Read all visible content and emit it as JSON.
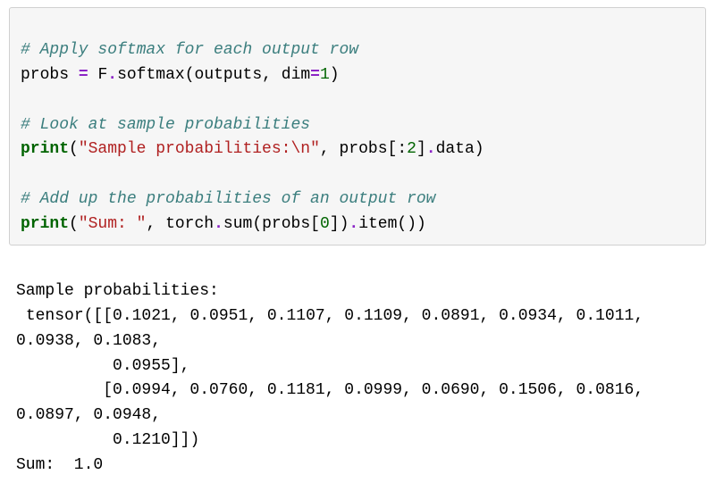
{
  "code": {
    "c1": "# Apply softmax for each output row",
    "l2_probs": "probs",
    "l2_sp1": " ",
    "l2_eq": "=",
    "l2_sp2": " ",
    "l2_F": "F",
    "l2_dot1": ".",
    "l2_softmax": "softmax",
    "l2_open": "(",
    "l2_outputs": "outputs",
    "l2_comma": ",",
    "l2_sp3": " ",
    "l2_dim": "dim",
    "l2_eq2": "=",
    "l2_one": "1",
    "l2_close": ")",
    "blank1": "",
    "c2": "# Look at sample probabilities",
    "l5_print": "print",
    "l5_open": "(",
    "l5_str": "\"Sample probabilities:\\n\"",
    "l5_comma": ",",
    "l5_sp": " ",
    "l5_probs": "probs",
    "l5_br1": "[:",
    "l5_two": "2",
    "l5_br2": "]",
    "l5_dot": ".",
    "l5_data": "data",
    "l5_close": ")",
    "blank2": "",
    "c3": "# Add up the probabilities of an output row",
    "l8_print": "print",
    "l8_open": "(",
    "l8_str": "\"Sum: \"",
    "l8_comma": ",",
    "l8_sp": " ",
    "l8_torch": "torch",
    "l8_dot1": ".",
    "l8_sum": "sum",
    "l8_open2": "(",
    "l8_probs": "probs",
    "l8_br1": "[",
    "l8_zero": "0",
    "l8_br2": "]",
    "l8_close2": ")",
    "l8_dot2": ".",
    "l8_item": "item",
    "l8_parens": "()",
    "l8_close": ")"
  },
  "output": {
    "line1": "Sample probabilities:",
    "line2": " tensor([[0.1021, 0.0951, 0.1107, 0.1109, 0.0891, 0.0934, 0.1011, 0.0938, 0.1083,",
    "line3": "          0.0955],",
    "line4": "         [0.0994, 0.0760, 0.1181, 0.0999, 0.0690, 0.1506, 0.0816, 0.0897, 0.0948,",
    "line5": "          0.1210]])",
    "line6": "Sum:  1.0"
  }
}
